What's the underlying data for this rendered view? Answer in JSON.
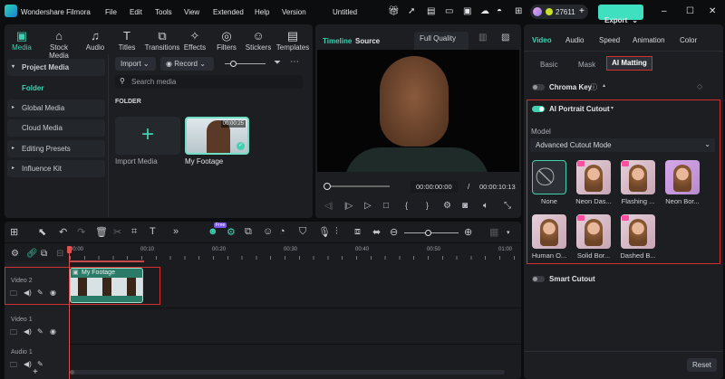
{
  "app": {
    "title": "Wondershare Filmora",
    "menu": [
      "File",
      "Edit",
      "Tools",
      "View",
      "Extended",
      "Help",
      "Version"
    ],
    "doc_title": "Untitled",
    "credits": "27611",
    "export_label": "Export"
  },
  "media_tabs": [
    {
      "label": "Media",
      "icon": "media-icon",
      "glyph": "▣"
    },
    {
      "label": "Stock Media",
      "icon": "stock-media-icon",
      "glyph": "⌂"
    },
    {
      "label": "Audio",
      "icon": "audio-icon",
      "glyph": "♫"
    },
    {
      "label": "Titles",
      "icon": "titles-icon",
      "glyph": "T"
    },
    {
      "label": "Transitions",
      "icon": "transitions-icon",
      "glyph": "⧉"
    },
    {
      "label": "Effects",
      "icon": "effects-icon",
      "glyph": "✧"
    },
    {
      "label": "Filters",
      "icon": "filters-icon",
      "glyph": "◎"
    },
    {
      "label": "Stickers",
      "icon": "stickers-icon",
      "glyph": "☺"
    },
    {
      "label": "Templates",
      "icon": "templates-icon",
      "glyph": "▤"
    }
  ],
  "sidebar": {
    "items": [
      {
        "label": "Project Media",
        "arrow": "▾"
      },
      {
        "label": "Folder"
      },
      {
        "label": "Global Media",
        "arrow": "▸"
      },
      {
        "label": "Cloud Media"
      },
      {
        "label": "Editing Presets",
        "arrow": "▸"
      },
      {
        "label": "Influence Kit",
        "arrow": "▸"
      }
    ]
  },
  "media": {
    "import_label": "Import",
    "record_label": "Record",
    "search_placeholder": "Search media",
    "folder_heading": "FOLDER",
    "items": [
      {
        "label": "Import Media"
      },
      {
        "label": "My Footage",
        "duration": "00:00:25"
      }
    ]
  },
  "preview": {
    "tabs": [
      "Timeline",
      "Source"
    ],
    "quality": "Full Quality",
    "current_time": "00:00:00:00",
    "separator": "/",
    "total_time": "00:00:10:13"
  },
  "right": {
    "tabs": [
      "Video",
      "Audio",
      "Speed",
      "Animation",
      "Color"
    ],
    "subtabs": [
      "Basic",
      "Mask",
      "AI Matting"
    ],
    "chroma_key": "Chroma Key",
    "portrait_cutout": "AI Portrait Cutout",
    "model_label": "Model",
    "model_value": "Advanced Cutout Mode",
    "effects": [
      "None",
      "Neon Das...",
      "Flashing ...",
      "Neon Bor...",
      "Human O...",
      "Solid Bor...",
      "Dashed B..."
    ],
    "smart_cutout": "Smart Cutout",
    "reset_label": "Reset"
  },
  "timeline": {
    "ticks": [
      "00:00",
      "00:10",
      "00:20",
      "00:30",
      "00:40",
      "00:50",
      "01:00"
    ],
    "tracks": [
      "Video 2",
      "Video 1",
      "Audio 1"
    ],
    "clip_label": "My Footage",
    "ai_badge": "Free"
  },
  "colors": {
    "accent": "#3fd1b0",
    "highlight": "#d0302f",
    "bg": "#1c1e22"
  }
}
